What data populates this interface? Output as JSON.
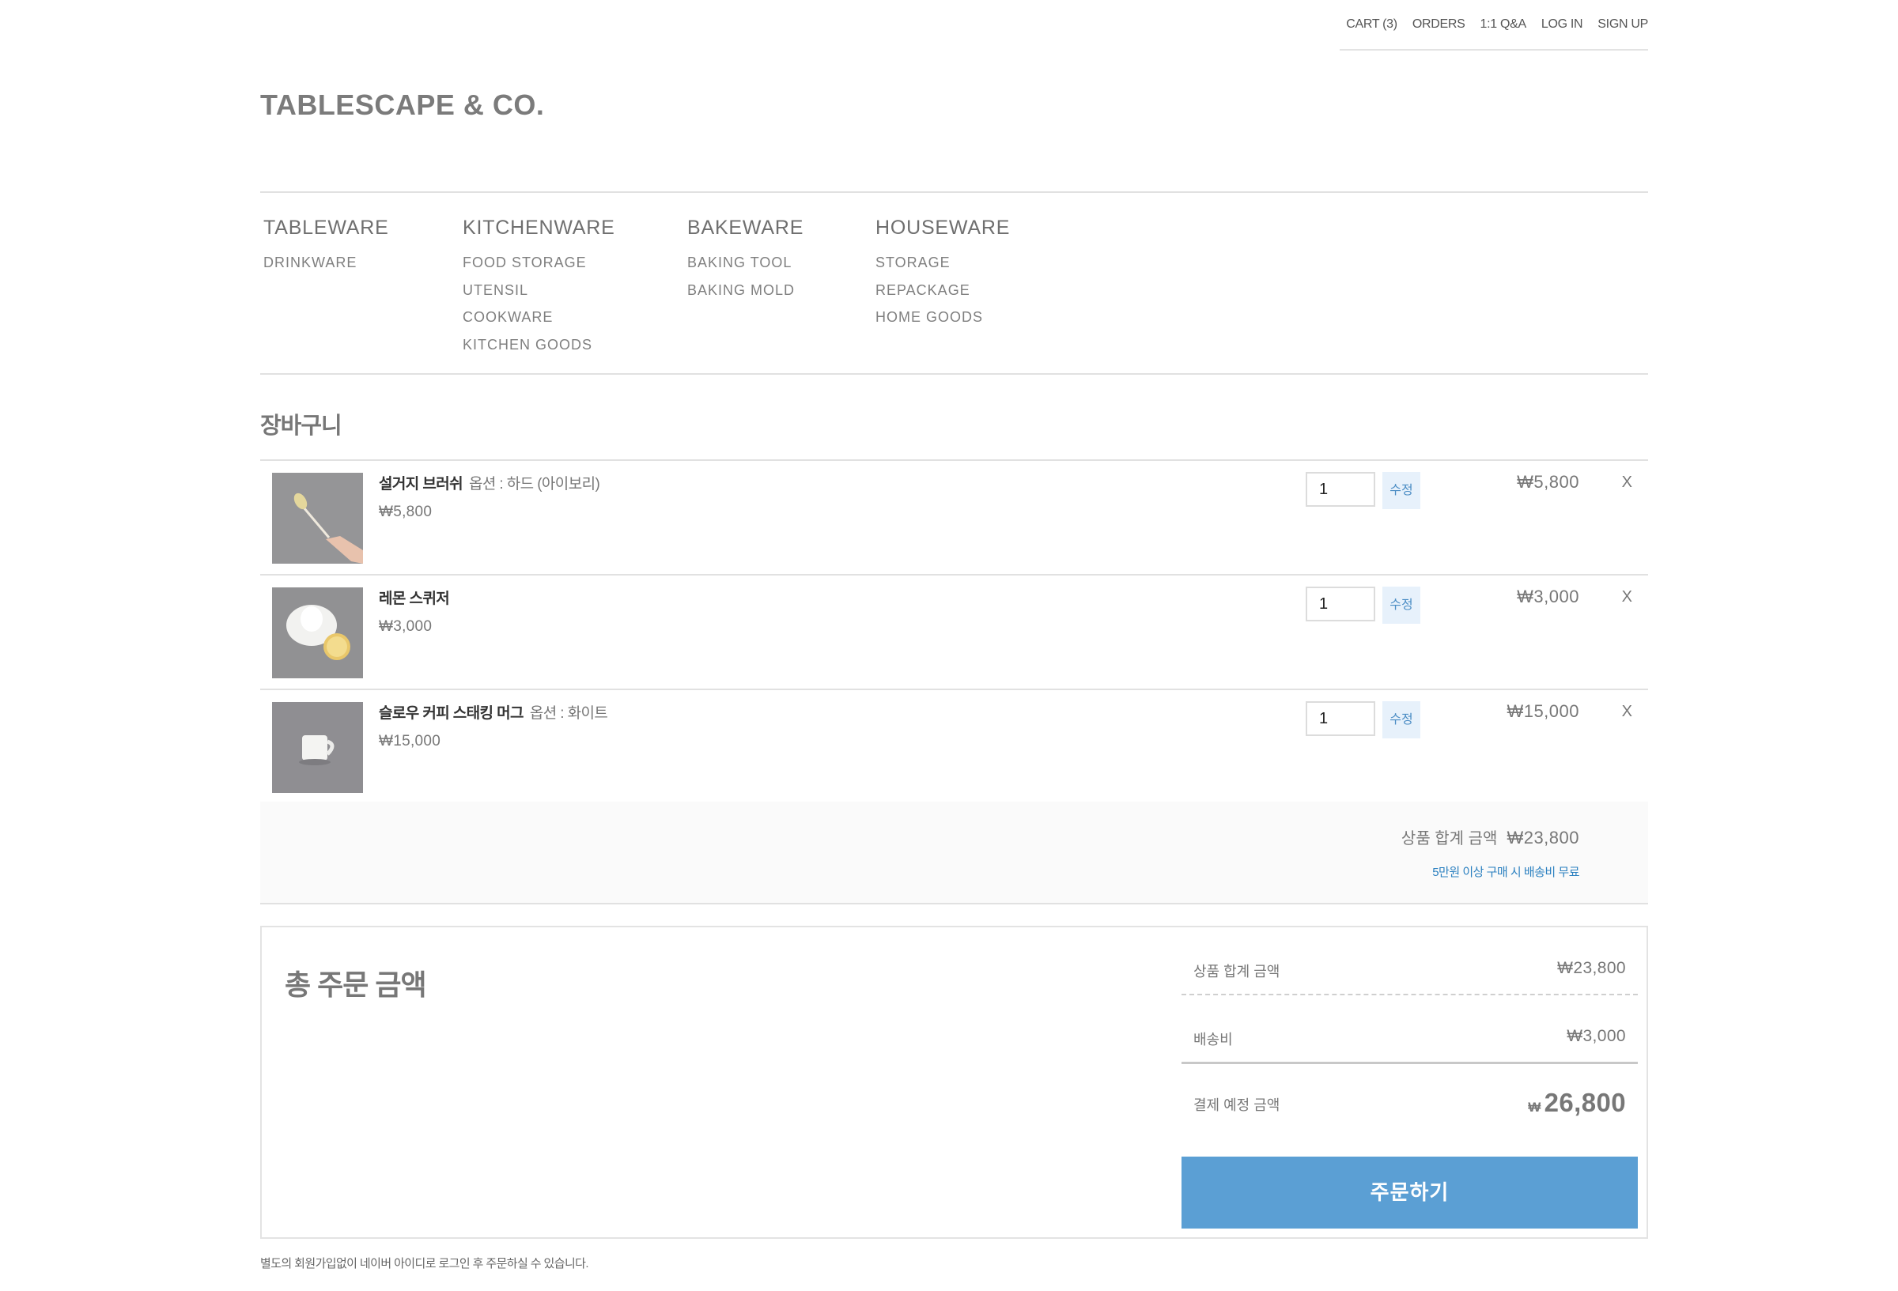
{
  "util_nav": [
    "CART (3)",
    "ORDERS",
    "1:1 Q&A",
    "LOG IN",
    "SIGN UP"
  ],
  "logo": "TABLESCAPE & CO.",
  "categories": [
    {
      "head": "TABLEWARE",
      "subs": [
        "DRINKWARE"
      ]
    },
    {
      "head": "KITCHENWARE",
      "subs": [
        "FOOD STORAGE",
        "UTENSIL",
        "COOKWARE",
        "KITCHEN GOODS"
      ]
    },
    {
      "head": "BAKEWARE",
      "subs": [
        "BAKING TOOL",
        "BAKING MOLD"
      ]
    },
    {
      "head": "HOUSEWARE",
      "subs": [
        "STORAGE",
        "REPACKAGE",
        "HOME GOODS"
      ]
    }
  ],
  "cart_title": "장바구니",
  "items": [
    {
      "name": "설거지 브러쉬",
      "option": "옵션 : 하드 (아이보리)",
      "unit_price": "₩5,800",
      "qty": "1",
      "edit": "수정",
      "line_price": "₩5,800",
      "remove": "X",
      "image": "brush-photo"
    },
    {
      "name": "레몬 스퀴저",
      "option": "",
      "unit_price": "₩3,000",
      "qty": "1",
      "edit": "수정",
      "line_price": "₩3,000",
      "remove": "X",
      "image": "lemon-squeezer-photo"
    },
    {
      "name": "슬로우 커피 스태킹 머그",
      "option": "옵션 : 화이트",
      "unit_price": "₩15,000",
      "qty": "1",
      "edit": "수정",
      "line_price": "₩15,000",
      "remove": "X",
      "image": "mug-photo"
    }
  ],
  "subtotal": {
    "label": "상품 합계 금액",
    "value": "₩23,800",
    "free_shipping": "5만원 이상 구매 시 배송비 무료"
  },
  "total": {
    "title": "총 주문 금액",
    "product_label": "상품 합계 금액",
    "product_value": "₩23,800",
    "shipping_label": "배송비",
    "shipping_value": "₩3,000",
    "grand_label": "결제 예정 금액",
    "grand_currency": "₩",
    "grand_value": "26,800",
    "order_button": "주문하기"
  },
  "note": "별도의 회원가입없이 네이버 아이디로 로그인 후 주문하실 수 있습니다.",
  "colors": {
    "accent": "#5b9fd4",
    "edit_bg": "#e7f1fb",
    "link": "#2b80c0"
  }
}
